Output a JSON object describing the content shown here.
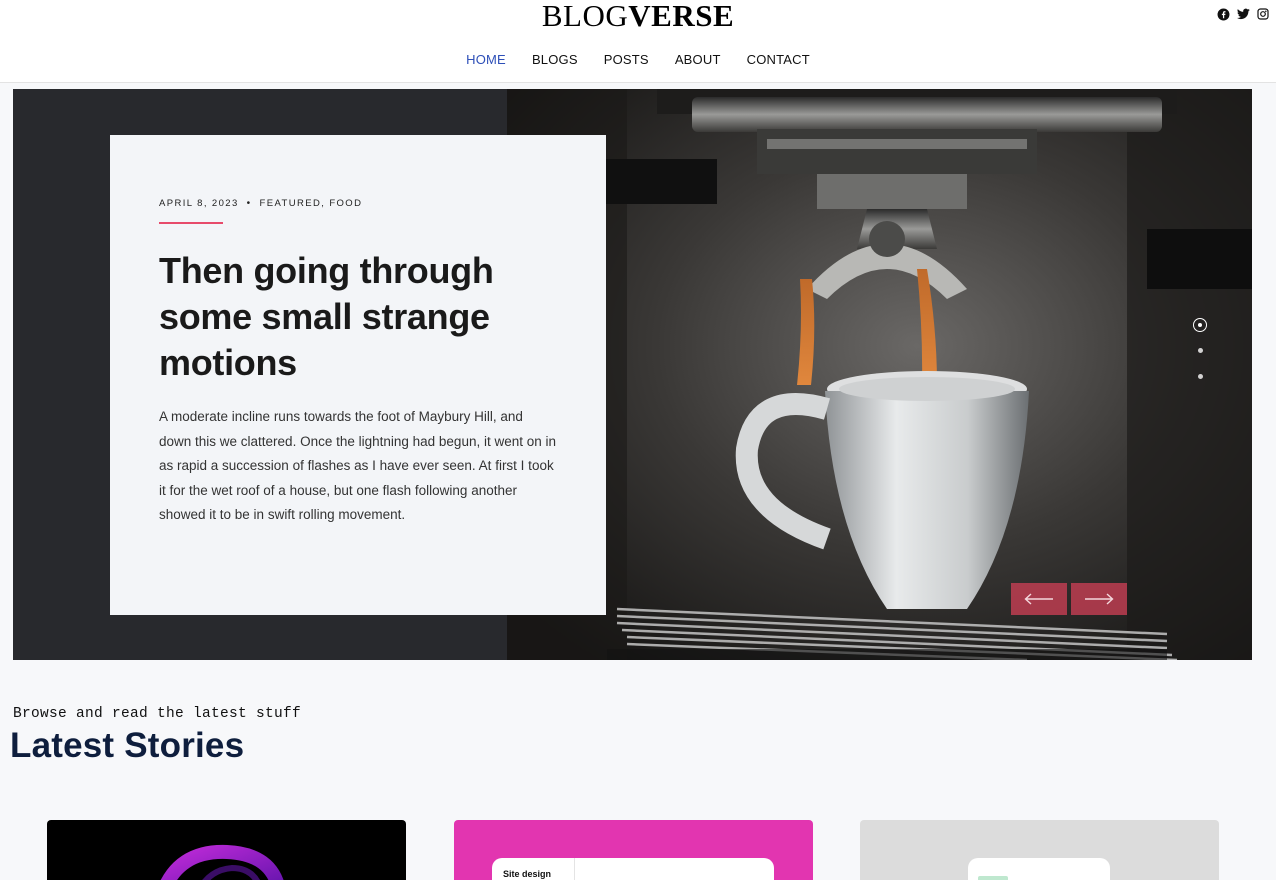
{
  "header": {
    "logo_thin": "BLOG",
    "logo_bold": "VERSE",
    "social": [
      "facebook-icon",
      "twitter-icon",
      "instagram-icon"
    ],
    "nav": [
      {
        "label": "HOME",
        "active": true
      },
      {
        "label": "BLOGS",
        "active": false
      },
      {
        "label": "POSTS",
        "active": false
      },
      {
        "label": "ABOUT",
        "active": false
      },
      {
        "label": "CONTACT",
        "active": false
      }
    ]
  },
  "hero": {
    "date": "APRIL 8, 2023",
    "separator": "•",
    "categories": "FEATURED, FOOD",
    "title": "Then going through some small strange motions",
    "excerpt": "A moderate incline runs towards the foot of Maybury Hill, and down this we clattered. Once the lightning had begun, it went on in as rapid a succession of flashes as I have ever seen. At first I took it for the wet roof of a house, but one flash following another showed it to be in swift rolling movement.",
    "slide_count": 3,
    "active_slide": 1,
    "prev_icon": "arrow-left-icon",
    "next_icon": "arrow-right-icon",
    "accent": "#e74b6b",
    "arrow_bg": "#cb3f55"
  },
  "latest": {
    "kicker": "Browse and read the latest stuff",
    "title": "Latest Stories",
    "cards": [
      {
        "bg": "#000000"
      },
      {
        "bg": "#e235b0",
        "label": "Site design"
      },
      {
        "bg": "#dcdcdc"
      }
    ]
  }
}
